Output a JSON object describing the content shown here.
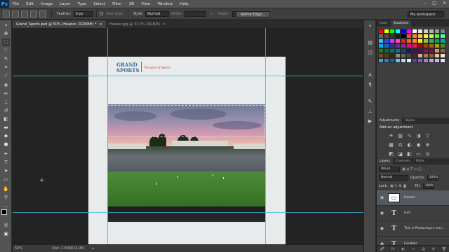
{
  "app": {
    "logo": "Ps"
  },
  "menu": [
    "File",
    "Edit",
    "Image",
    "Layer",
    "Type",
    "Select",
    "Filter",
    "3D",
    "View",
    "Window",
    "Help"
  ],
  "window_controls": [
    "–",
    "□",
    "✕"
  ],
  "options": {
    "position_label": "Feather:",
    "feather_value": "0 px",
    "antialias_label": "Anti-alias",
    "style_label": "Style:",
    "style_value": "Normal",
    "width_label": "Width:",
    "height_label": "Height:",
    "refine_label": "Refine Edge...",
    "workspace_value": "My workspace"
  },
  "tabs": [
    {
      "label": "Grand_Sports.psd @ 50% (Header, RGB/8#) *",
      "close": "×"
    },
    {
      "label": "Header.jpg @ 33.3% (RGB/8)",
      "close": "×"
    }
  ],
  "document": {
    "brand_line1": "GRAND",
    "brand_line2": "SPORTS",
    "tagline": "The word of Sports"
  },
  "status": {
    "zoom": "50%",
    "doc_info": "Doc: 1.64M/14.9M"
  },
  "panels": {
    "color_tabs": [
      "Color",
      "Swatches"
    ],
    "adjust_tabs": [
      "Adjustments",
      "Styles"
    ],
    "adjust_title": "Add an adjustment",
    "layers_tabs": [
      "Layers",
      "Channels",
      "Paths"
    ],
    "kind_value": "Kind",
    "blend_value": "Normal",
    "opacity_label": "Opacity:",
    "opacity_value": "100%",
    "lock_label": "Lock:",
    "fill_label": "Fill:",
    "fill_value": "100%",
    "layers": [
      {
        "name": "Header",
        "type": "image"
      },
      {
        "name": "Golf",
        "type": "text"
      },
      {
        "name": "This is Photoshop's vers...",
        "type": "text"
      },
      {
        "name": "Football",
        "type": "text"
      }
    ],
    "footer_icons": [
      "🔗",
      "fx",
      "◐",
      "▭",
      "▤",
      "⊕",
      "🗑"
    ]
  },
  "swatch_colors": [
    "#ff0000",
    "#ffff00",
    "#00ff00",
    "#00ffff",
    "#0000ff",
    "#ff00ff",
    "#ffffff",
    "#e6e6e6",
    "#cccccc",
    "#b3b3b3",
    "#999999",
    "#808080",
    "#666666",
    "#4d4d4d",
    "#333333",
    "#1a1a1a",
    "#000000",
    "#ff4040",
    "#ff8040",
    "#ffc040",
    "#fff040",
    "#c0ff40",
    "#40ff40",
    "#40ffc0",
    "#40c0ff",
    "#4040ff",
    "#c040ff",
    "#ff40c0",
    "#ee1c24",
    "#f26522",
    "#f7941d",
    "#fff200",
    "#8dc63f",
    "#39b54a",
    "#00a651",
    "#00a99d",
    "#00aeef",
    "#0072bc",
    "#2e3192",
    "#662d91",
    "#92278f",
    "#ec008c",
    "#ed145b",
    "#9e0b0f",
    "#a0410d",
    "#a36209",
    "#aba000",
    "#598527",
    "#1a7b30",
    "#007236",
    "#00746b",
    "#0076a3",
    "#004b80",
    "#1b1464",
    "#440e62",
    "#630460",
    "#9e005d",
    "#9e0039",
    "#c69c6d",
    "#8c6239",
    "#754c24",
    "#603913",
    "#3c2415",
    "#998675",
    "#736357",
    "#534741",
    "#362f2d",
    "#c7b299",
    "#a67c52",
    "#8c6239",
    "#e0c8a8",
    "#f5e6d0",
    "#3f9fd0",
    "#2f7fb0",
    "#1f5f90",
    "#6fbfe0",
    "#9fdff0",
    "#cfeff8",
    "#5f3f9f",
    "#7f5fbf",
    "#9f7fdf",
    "#bf9fef",
    "#d0b0f0",
    "#e8d8f8"
  ]
}
